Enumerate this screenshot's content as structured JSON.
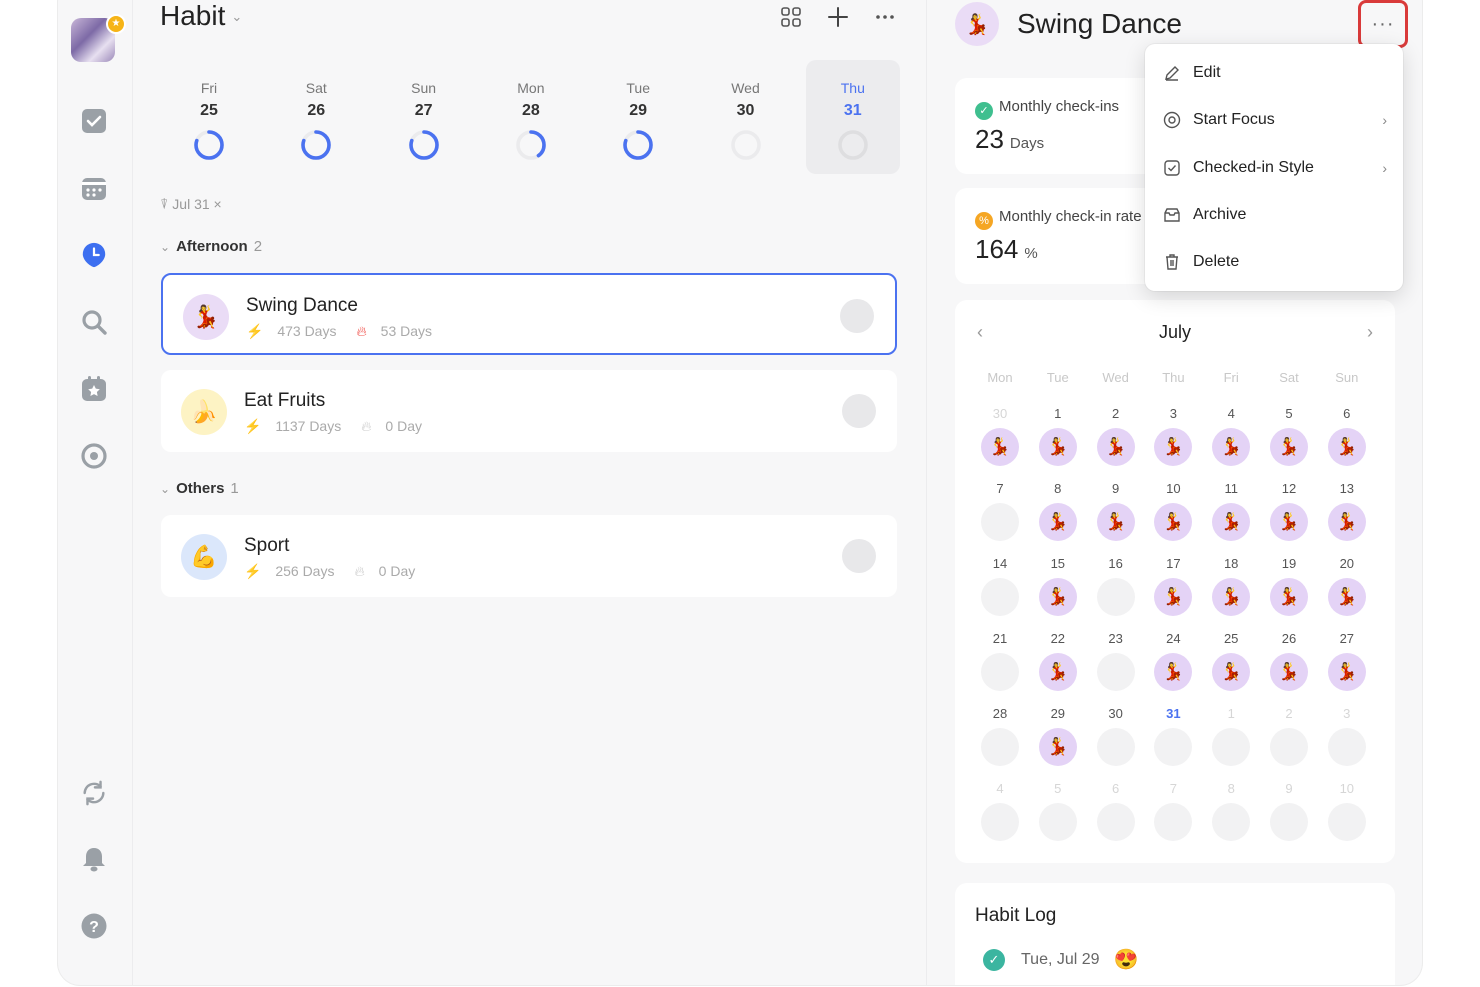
{
  "sidebar": {
    "items": [
      {
        "name": "tasks-icon"
      },
      {
        "name": "calendar-icon"
      },
      {
        "name": "habit-clock-icon"
      },
      {
        "name": "search-icon"
      },
      {
        "name": "countdown-icon"
      },
      {
        "name": "focus-icon"
      },
      {
        "name": "sync-icon"
      },
      {
        "name": "notifications-icon"
      },
      {
        "name": "help-icon"
      }
    ]
  },
  "header": {
    "title": "Habit"
  },
  "week": [
    {
      "dow": "Fri",
      "date": "25",
      "progress": 0.8
    },
    {
      "dow": "Sat",
      "date": "26",
      "progress": 0.8
    },
    {
      "dow": "Sun",
      "date": "27",
      "progress": 0.8
    },
    {
      "dow": "Mon",
      "date": "28",
      "progress": 0.4
    },
    {
      "dow": "Tue",
      "date": "29",
      "progress": 0.8
    },
    {
      "dow": "Wed",
      "date": "30",
      "progress": 0
    },
    {
      "dow": "Thu",
      "date": "31",
      "progress": 0,
      "selected": true
    }
  ],
  "filter": {
    "label": "Jul 31",
    "clear": "×"
  },
  "groups": {
    "afternoon": {
      "label": "Afternoon",
      "count": "2"
    },
    "others": {
      "label": "Others",
      "count": "1"
    }
  },
  "habits": [
    {
      "name": "Swing Dance",
      "total": "473 Days",
      "streak": "53 Days",
      "emoji": "💃",
      "bg": "#eadcf6",
      "streak_color": "#f0504a"
    },
    {
      "name": "Eat Fruits",
      "total": "1137 Days",
      "streak": "0 Day",
      "emoji": "🍌",
      "bg": "#fdf3c4",
      "streak_color": "#cccccc"
    },
    {
      "name": "Sport",
      "total": "256 Days",
      "streak": "0 Day",
      "emoji": "💪",
      "bg": "#dbe7fb",
      "streak_color": "#cccccc"
    }
  ],
  "detail": {
    "title": "Swing Dance",
    "emoji": "💃",
    "more": "···",
    "stats": [
      {
        "label": "Monthly check-ins",
        "value": "23",
        "unit": "Days",
        "color": "#3fbf8f"
      },
      {
        "label": "Monthly check-in rate",
        "value": "164",
        "unit": "%",
        "color": "#f5a623"
      }
    ],
    "calendar": {
      "month": "July",
      "weekdays": [
        "Mon",
        "Tue",
        "Wed",
        "Thu",
        "Fri",
        "Sat",
        "Sun"
      ],
      "today": "31",
      "cells": [
        {
          "d": "30",
          "faint": true,
          "on": true
        },
        {
          "d": "1",
          "on": true
        },
        {
          "d": "2",
          "on": true
        },
        {
          "d": "3",
          "on": true
        },
        {
          "d": "4",
          "on": true
        },
        {
          "d": "5",
          "on": true
        },
        {
          "d": "6",
          "on": true
        },
        {
          "d": "7"
        },
        {
          "d": "8",
          "on": true
        },
        {
          "d": "9",
          "on": true
        },
        {
          "d": "10",
          "on": true
        },
        {
          "d": "11",
          "on": true
        },
        {
          "d": "12",
          "on": true
        },
        {
          "d": "13",
          "on": true
        },
        {
          "d": "14"
        },
        {
          "d": "15",
          "on": true
        },
        {
          "d": "16"
        },
        {
          "d": "17",
          "on": true
        },
        {
          "d": "18",
          "on": true
        },
        {
          "d": "19",
          "on": true
        },
        {
          "d": "20",
          "on": true
        },
        {
          "d": "21"
        },
        {
          "d": "22",
          "on": true
        },
        {
          "d": "23"
        },
        {
          "d": "24",
          "on": true
        },
        {
          "d": "25",
          "on": true
        },
        {
          "d": "26",
          "on": true
        },
        {
          "d": "27",
          "on": true
        },
        {
          "d": "28"
        },
        {
          "d": "29",
          "on": true
        },
        {
          "d": "30"
        },
        {
          "d": "31",
          "today": true
        },
        {
          "d": "1",
          "faint": true
        },
        {
          "d": "2",
          "faint": true
        },
        {
          "d": "3",
          "faint": true
        },
        {
          "d": "4",
          "faint": true
        },
        {
          "d": "5",
          "faint": true
        },
        {
          "d": "6",
          "faint": true
        },
        {
          "d": "7",
          "faint": true
        },
        {
          "d": "8",
          "faint": true
        },
        {
          "d": "9",
          "faint": true
        },
        {
          "d": "10",
          "faint": true
        }
      ]
    },
    "log": {
      "title": "Habit Log",
      "entries": [
        {
          "date": "Tue, Jul 29",
          "emoji": "😍"
        }
      ]
    }
  },
  "menu": {
    "items": [
      {
        "label": "Edit",
        "icon": "pencil-icon",
        "submenu": false
      },
      {
        "label": "Start Focus",
        "icon": "focus-target-icon",
        "submenu": true
      },
      {
        "label": "Checked-in Style",
        "icon": "checkbox-icon",
        "submenu": true
      },
      {
        "label": "Archive",
        "icon": "archive-icon",
        "submenu": false
      },
      {
        "label": "Delete",
        "icon": "trash-icon",
        "submenu": false
      }
    ]
  },
  "colors": {
    "accent": "#4b72f0",
    "highlight": "#d93a3a"
  }
}
